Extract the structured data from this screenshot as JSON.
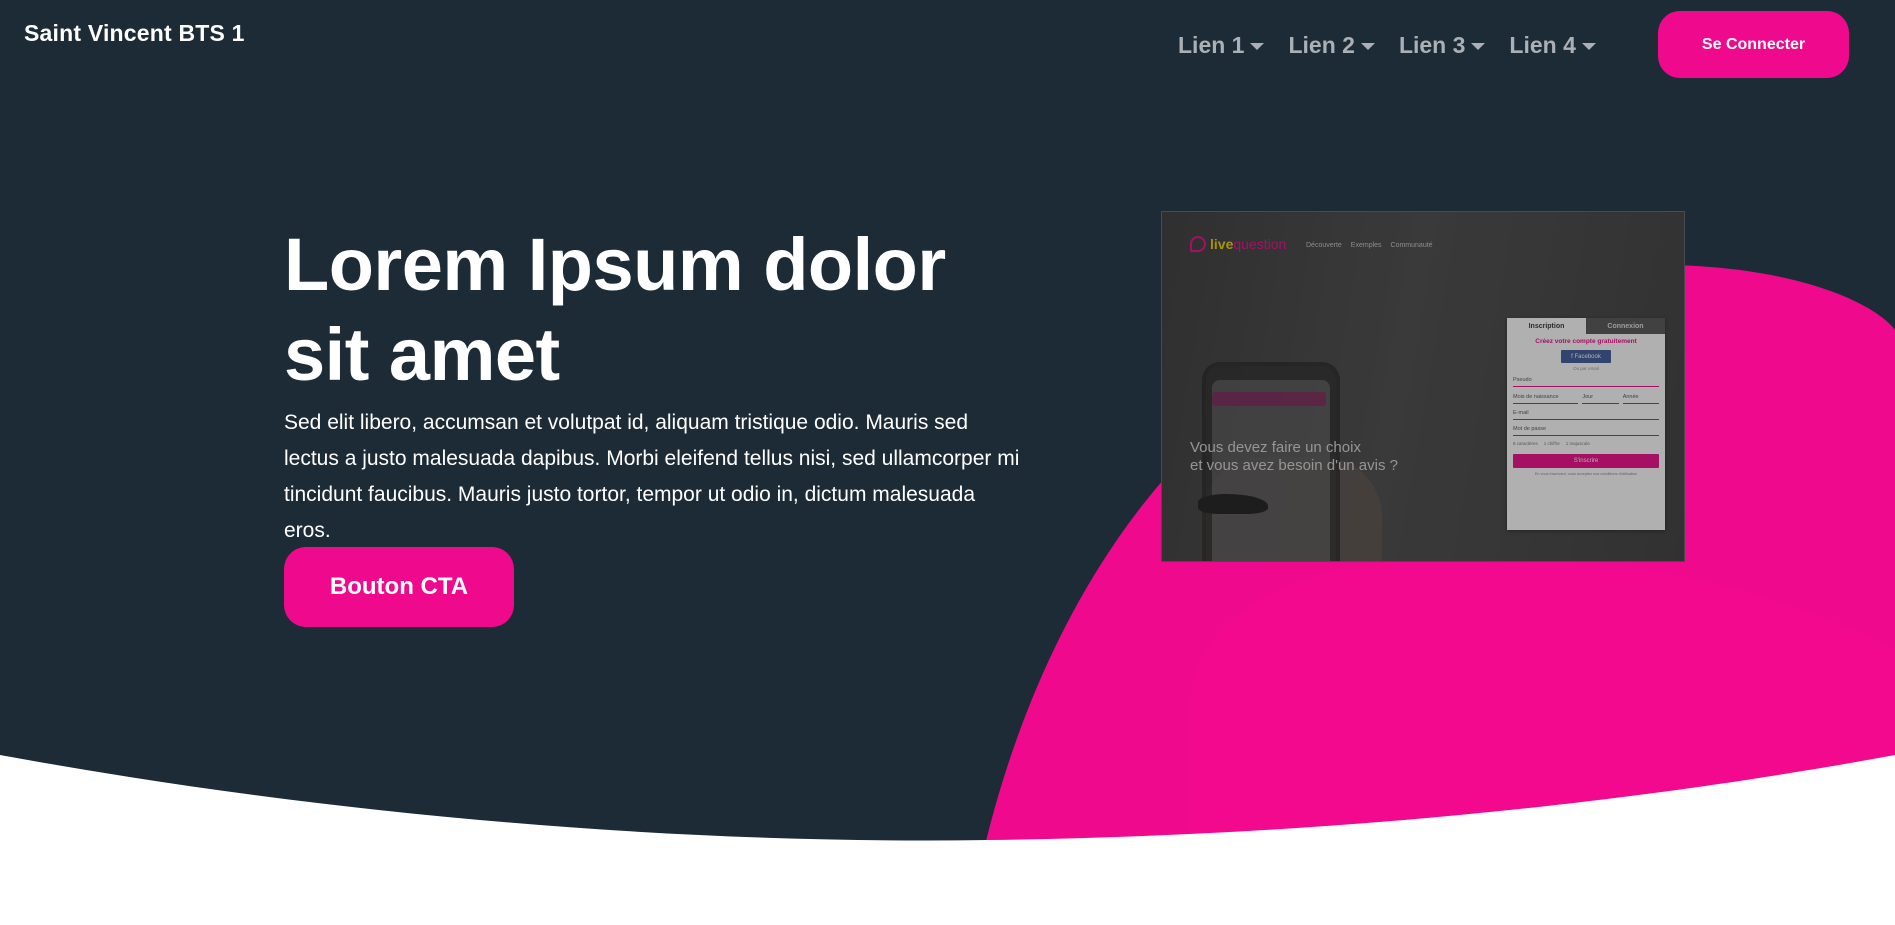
{
  "header": {
    "brand": "Saint Vincent BTS 1",
    "nav": [
      {
        "label": "Lien 1"
      },
      {
        "label": "Lien 2"
      },
      {
        "label": "Lien 3"
      },
      {
        "label": "Lien 4"
      }
    ],
    "login_label": "Se Connecter"
  },
  "hero": {
    "title": "Lorem Ipsum dolor sit amet",
    "text": "Sed elit libero, accumsan et volutpat id, aliquam tristique odio. Mauris sed lectus a justo malesuada dapibus. Morbi eleifend tellus nisi, sed ullamcorper mi tincidunt faucibus. Mauris justo tortor, tempor ut odio in, dictum malesuada eros.",
    "cta_label": "Bouton CTA"
  },
  "screenshot": {
    "logo_live": "live",
    "logo_question": "question",
    "links": [
      "Découverte",
      "Exemples",
      "Communauté"
    ],
    "tagline_line1": "Vous devez faire un choix",
    "tagline_line2": "et vous avez besoin d'un avis ?",
    "form": {
      "tab_signup": "Inscription",
      "tab_login": "Connexion",
      "heading": "Créez votre compte gratuitement",
      "facebook": "f  Facebook",
      "or_email": "Ou par email",
      "pseudo": "Pseudo",
      "birth_month": "Mois de naissance",
      "day": "Jour",
      "year": "Année",
      "email": "E-mail",
      "password": "Mot de passe",
      "radios": [
        "8 caractères",
        "1 chiffre",
        "1 majuscule"
      ],
      "submit": "S'inscrire",
      "legal": "En vous inscrivant, vous acceptez nos conditions d'utilisation"
    }
  },
  "colors": {
    "background": "#1c2b35",
    "accent": "#ef0a8d",
    "nav_text": "#aab0b5"
  }
}
